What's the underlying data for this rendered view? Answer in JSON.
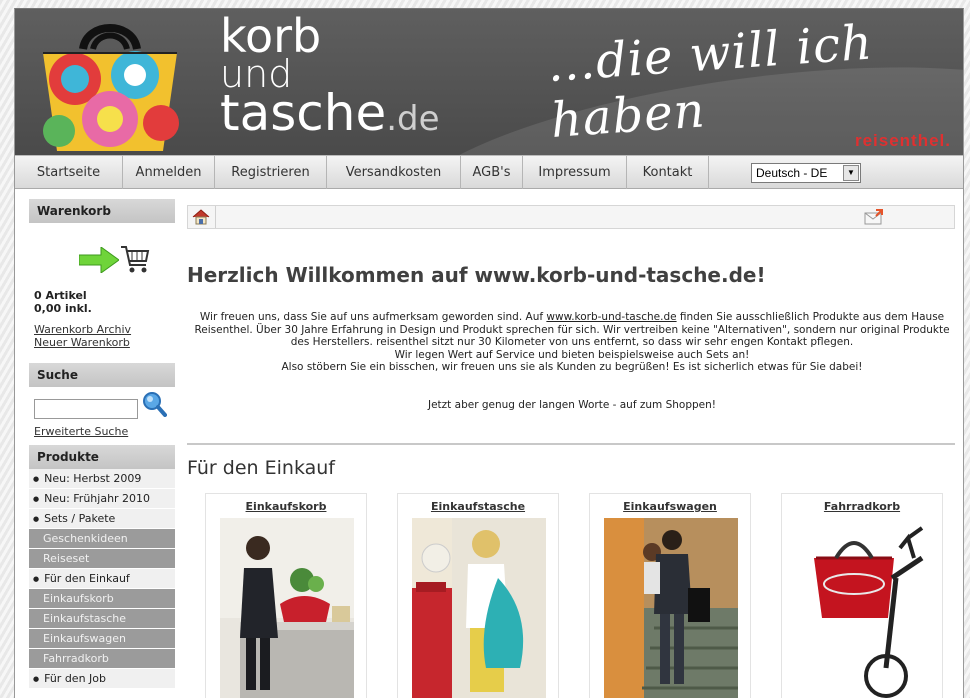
{
  "header": {
    "logo_l1": "korb",
    "logo_l2": "und",
    "logo_l3": "tasche",
    "logo_tld": ".de",
    "tagline": "…die will ich haben",
    "brand": "reisenthel."
  },
  "nav": {
    "items": [
      "Startseite",
      "Anmelden",
      "Registrieren",
      "Versandkosten",
      "AGB's",
      "Impressum",
      "Kontakt"
    ],
    "language_selected": "Deutsch - DE"
  },
  "sidebar": {
    "cart_title": "Warenkorb",
    "cart_count": "0 Artikel",
    "cart_total": "0,00 inkl.",
    "cart_archive": "Warenkorb Archiv",
    "cart_new": "Neuer Warenkorb",
    "search_title": "Suche",
    "search_placeholder": "",
    "advanced_search": "Erweiterte Suche",
    "products_title": "Produkte",
    "categories": [
      {
        "label": "Neu: Herbst 2009",
        "level": "top"
      },
      {
        "label": "Neu: Frühjahr 2010",
        "level": "top"
      },
      {
        "label": "Sets / Pakete",
        "level": "top"
      },
      {
        "label": "Geschenkideen",
        "level": "sub"
      },
      {
        "label": "Reiseset",
        "level": "sub"
      },
      {
        "label": "Für den Einkauf",
        "level": "top"
      },
      {
        "label": "Einkaufskorb",
        "level": "sub"
      },
      {
        "label": "Einkaufstasche",
        "level": "sub"
      },
      {
        "label": "Einkaufswagen",
        "level": "sub"
      },
      {
        "label": "Fahrradkorb",
        "level": "sub"
      },
      {
        "label": "Für den Job",
        "level": "top"
      }
    ]
  },
  "main": {
    "welcome": "Herzlich Willkommen auf www.korb-und-tasche.de!",
    "intro_pre": "Wir freuen uns, dass Sie auf uns aufmerksam geworden sind. Auf ",
    "intro_link": "www.korb-und-tasche.de",
    "intro_post": " finden Sie ausschließlich Produkte aus dem Hause Reisenthel. Über 30 Jahre Erfahrung in Design und Produkt sprechen für sich. Wir vertreiben keine \"Alternativen\", sondern nur original Produkte des Herstellers. reisenthel sitzt nur 30 Kilometer von uns entfernt, so dass wir sehr engen Kontakt pflegen.",
    "intro_line2": "Wir legen Wert auf Service und bieten beispielsweise auch Sets an!",
    "intro_line3": "Also stöbern Sie ein bisschen, wir freuen uns sie als Kunden zu begrüßen! Es ist sicherlich etwas für Sie dabei!",
    "shop_now": "Jetzt aber genug der langen Worte - auf zum Shoppen!",
    "section_title": "Für den Einkauf",
    "products": [
      {
        "name": "Einkaufskorb"
      },
      {
        "name": "Einkaufstasche"
      },
      {
        "name": "Einkaufswagen"
      },
      {
        "name": "Fahrradkorb"
      }
    ]
  },
  "colors": {
    "header_bg": "#555555",
    "brand_red": "#e03030",
    "nav_bg": "#e4e4e4",
    "sub_category_bg": "#9b9b9b"
  }
}
